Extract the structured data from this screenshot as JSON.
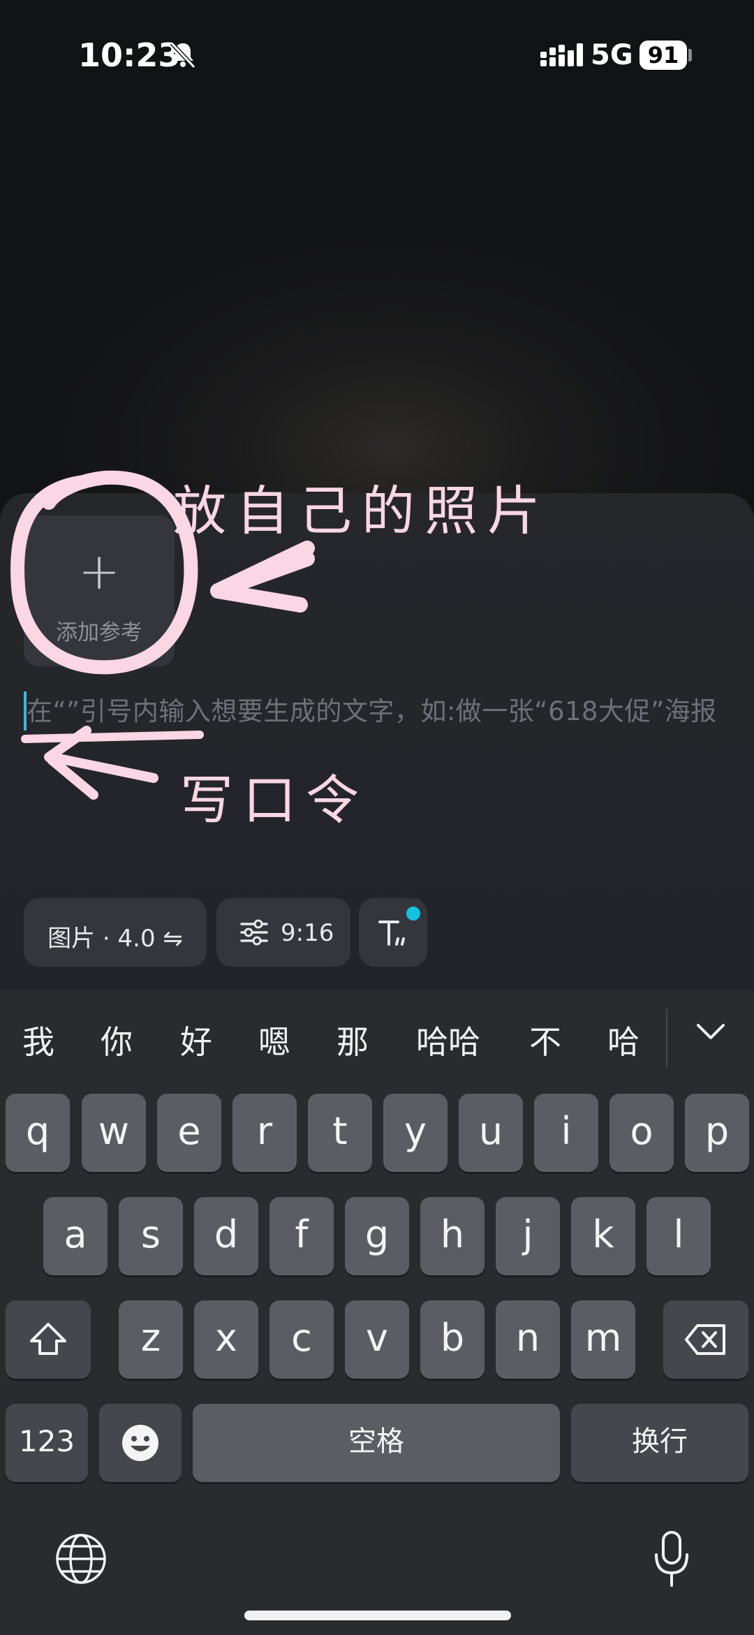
{
  "status_bar": {
    "time": "10:23",
    "network": "5G",
    "battery": "91"
  },
  "composer": {
    "add_reference_label": "添加参考",
    "prompt_placeholder": "在“”引号内输入想要生成的文字，如:做一张“618大促”海报",
    "chips": {
      "model": "图片 · 4.0 ⇋",
      "ratio": "9:16"
    }
  },
  "annotations": {
    "photo_hint": "放自己的照片",
    "prompt_hint": "写口令"
  },
  "keyboard": {
    "candidates": [
      "我",
      "你",
      "好",
      "嗯",
      "那",
      "哈哈",
      "不",
      "哈"
    ],
    "row1": [
      "q",
      "w",
      "e",
      "r",
      "t",
      "y",
      "u",
      "i",
      "o",
      "p"
    ],
    "row2": [
      "a",
      "s",
      "d",
      "f",
      "g",
      "h",
      "j",
      "k",
      "l"
    ],
    "row3": [
      "z",
      "x",
      "c",
      "v",
      "b",
      "n",
      "m"
    ],
    "numbers_key": "123",
    "space_key": "空格",
    "return_key": "换行"
  },
  "colors": {
    "accent": "#13c2e0",
    "annotation": "#fbd6e4"
  }
}
